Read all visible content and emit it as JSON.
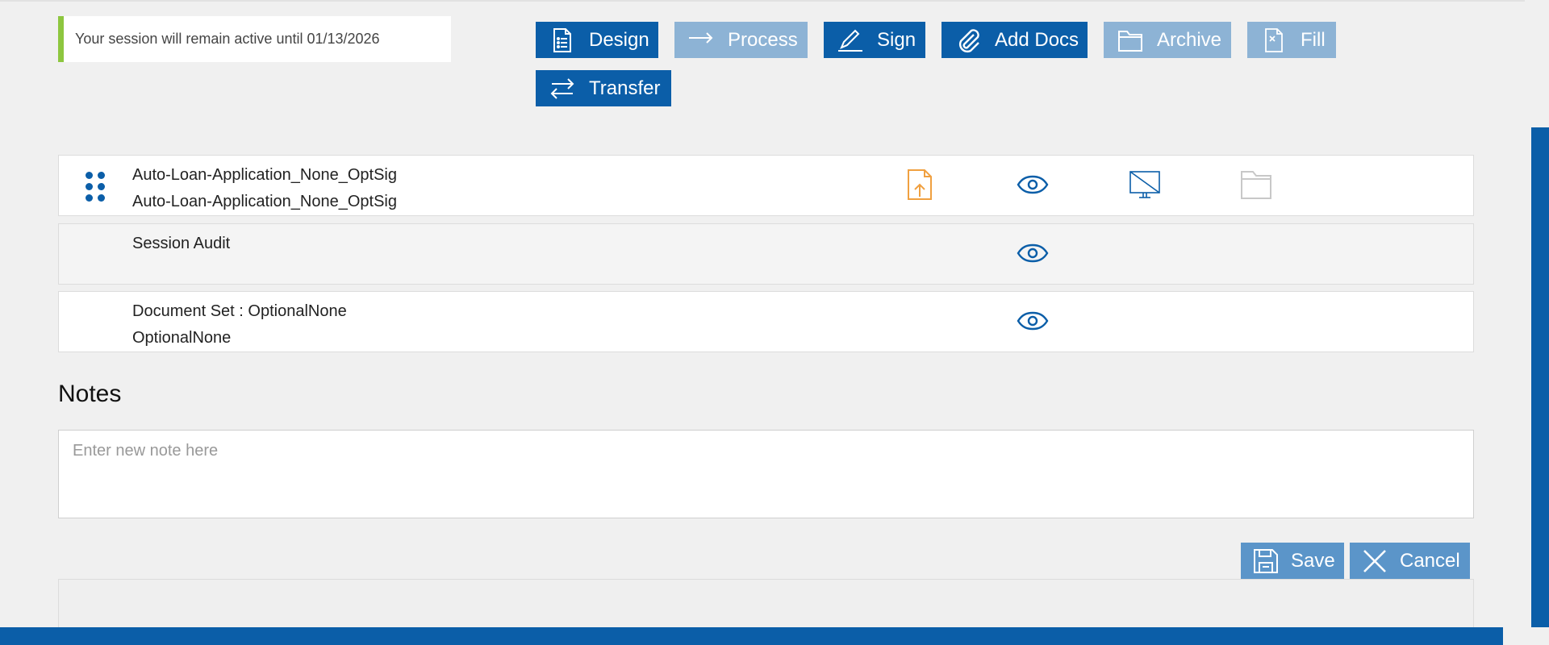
{
  "session": {
    "message": "Your session will remain active until 01/13/2026"
  },
  "toolbar": {
    "design": "Design",
    "process": "Process",
    "sign": "Sign",
    "add_docs": "Add Docs",
    "archive": "Archive",
    "fill": "Fill",
    "transfer": "Transfer"
  },
  "documents": [
    {
      "line1": "Auto-Loan-Application_None_OptSig",
      "line2": "Auto-Loan-Application_None_OptSig"
    },
    {
      "line1": "Session Audit",
      "line2": ""
    },
    {
      "line1": "Document Set : OptionalNone",
      "line2": "OptionalNone"
    }
  ],
  "notes": {
    "title": "Notes",
    "placeholder": "Enter new note here"
  },
  "actions": {
    "save": "Save",
    "cancel": "Cancel"
  },
  "colors": {
    "primary": "#0b5ea8",
    "disabled": "#8db3d5",
    "action": "#5b95c9",
    "accent_green": "#8dc63f",
    "upload_orange": "#f0a040"
  }
}
